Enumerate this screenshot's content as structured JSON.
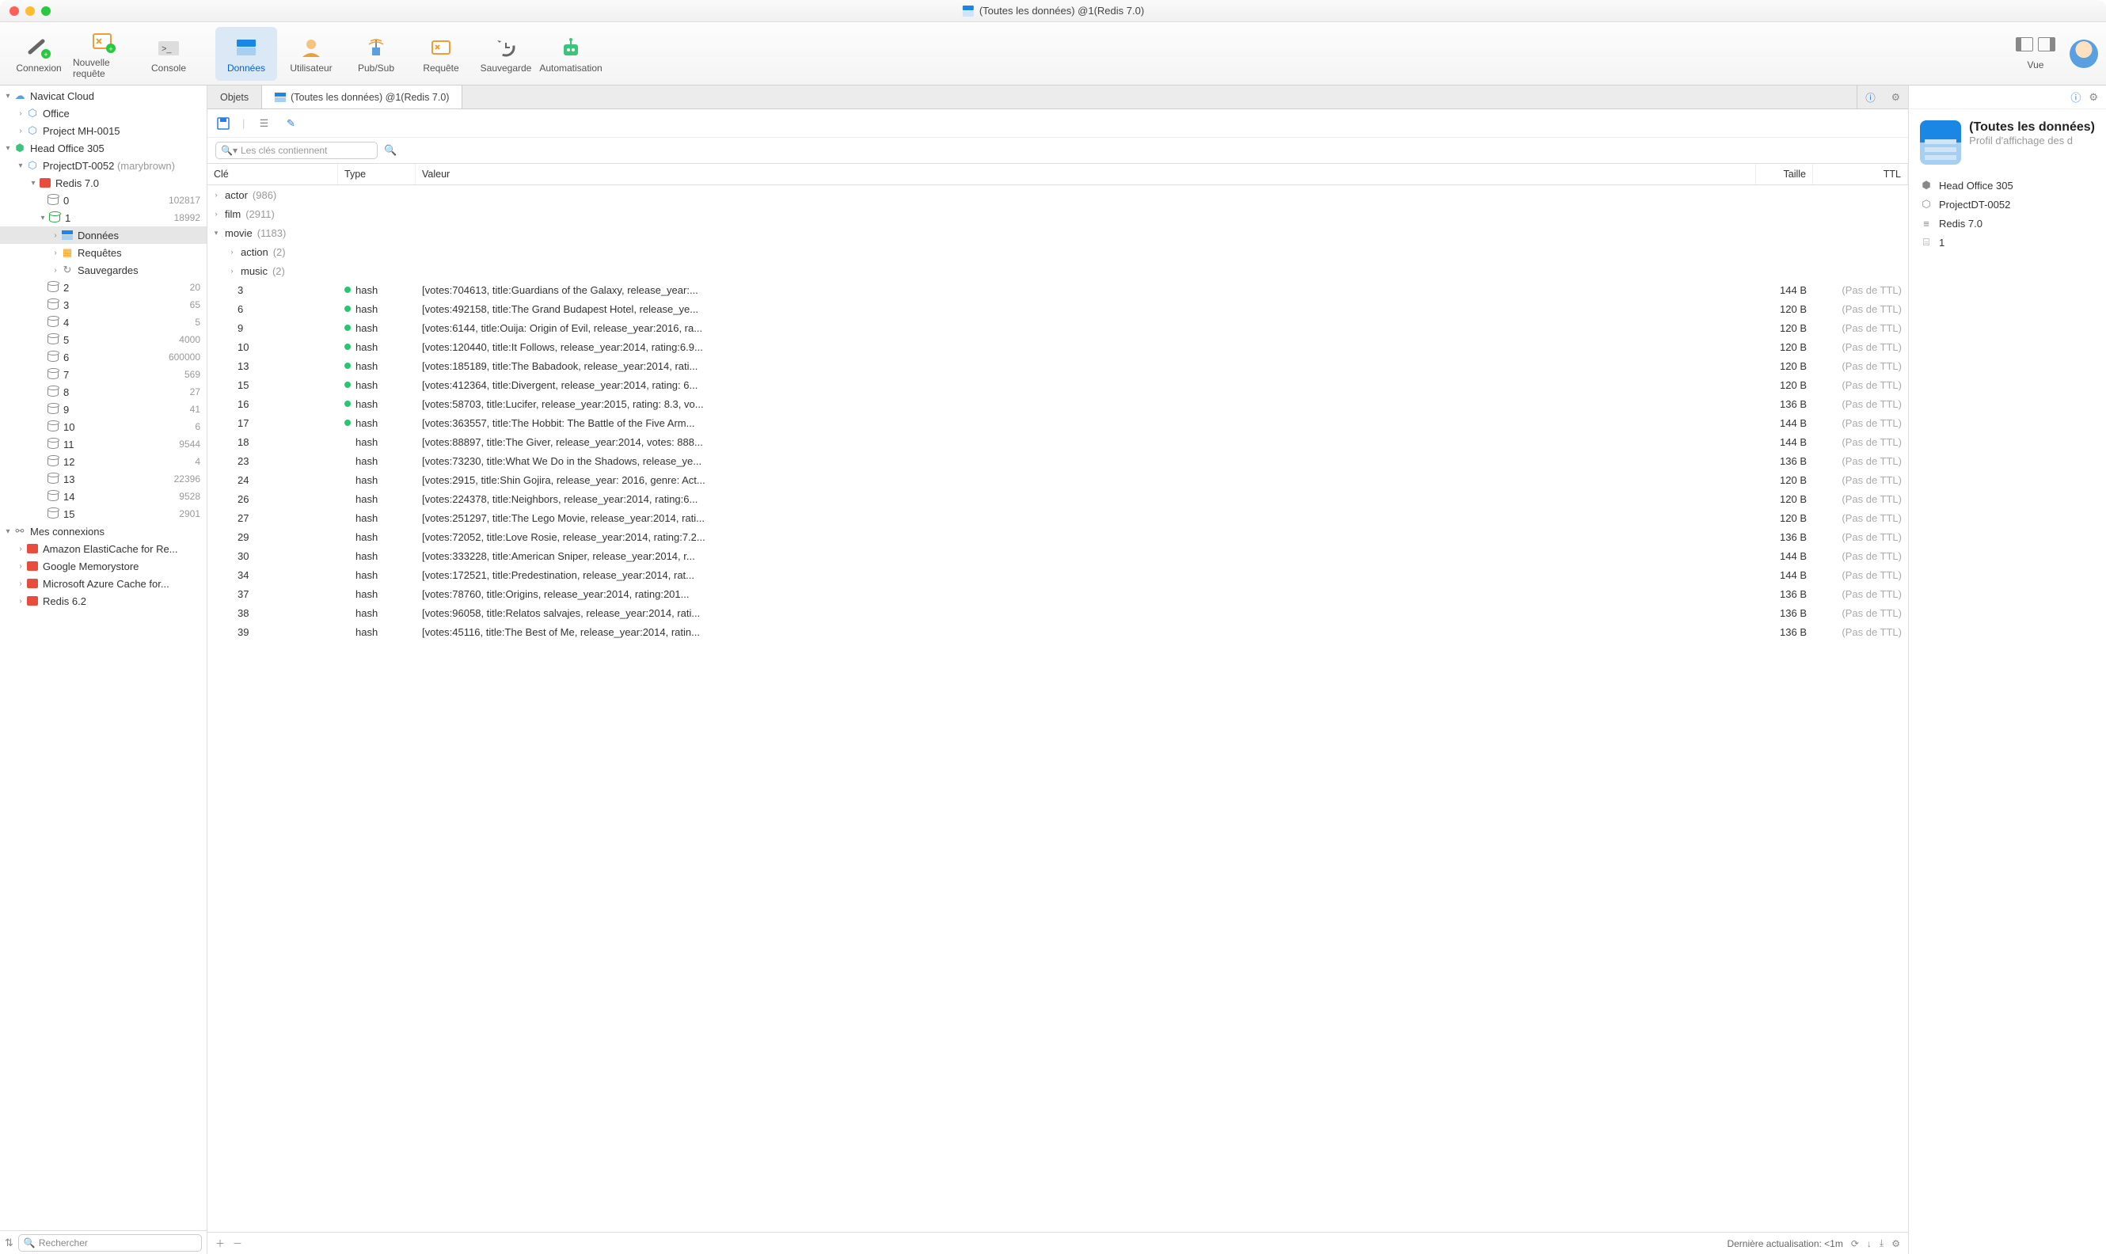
{
  "title": "(Toutes les données) @1(Redis 7.0)",
  "toolbar": {
    "connexion": "Connexion",
    "nouvelle_requete": "Nouvelle requête",
    "console": "Console",
    "donnees": "Données",
    "utilisateur": "Utilisateur",
    "pubsub": "Pub/Sub",
    "requete": "Requête",
    "sauvegarde": "Sauvegarde",
    "automatisation": "Automatisation",
    "vue": "Vue"
  },
  "sidebar": {
    "navicat_cloud": "Navicat Cloud",
    "office": "Office",
    "project_mh": "Project MH-0015",
    "head_office": "Head Office 305",
    "projectdt": "ProjectDT-0052",
    "projectdt_sub": "(marybrown)",
    "redis70": "Redis 7.0",
    "db0": "0",
    "db0_badge": "102817",
    "db1": "1",
    "db1_badge": "18992",
    "donnees": "Données",
    "requetes": "Requêtes",
    "sauvegardes": "Sauvegardes",
    "dbs": [
      {
        "n": "2",
        "b": "20"
      },
      {
        "n": "3",
        "b": "65"
      },
      {
        "n": "4",
        "b": "5"
      },
      {
        "n": "5",
        "b": "4000"
      },
      {
        "n": "6",
        "b": "600000"
      },
      {
        "n": "7",
        "b": "569"
      },
      {
        "n": "8",
        "b": "27"
      },
      {
        "n": "9",
        "b": "41"
      },
      {
        "n": "10",
        "b": "6"
      },
      {
        "n": "11",
        "b": "9544"
      },
      {
        "n": "12",
        "b": "4"
      },
      {
        "n": "13",
        "b": "22396"
      },
      {
        "n": "14",
        "b": "9528"
      },
      {
        "n": "15",
        "b": "2901"
      }
    ],
    "mes_connexions": "Mes connexions",
    "conn1": "Amazon ElastiCache for Re...",
    "conn2": "Google Memorystore",
    "conn3": "Microsoft Azure Cache for...",
    "conn4": "Redis 6.2",
    "search_placeholder": "Rechercher"
  },
  "tabs": {
    "objets": "Objets",
    "data_tab": "(Toutes les données) @1(Redis 7.0)"
  },
  "filter": {
    "placeholder": "Les clés contiennent"
  },
  "columns": {
    "cle": "Clé",
    "type": "Type",
    "valeur": "Valeur",
    "taille": "Taille",
    "ttl": "TTL"
  },
  "groups": {
    "actor": "actor",
    "actor_n": "(986)",
    "film": "film",
    "film_n": "(2911)",
    "movie": "movie",
    "movie_n": "(1183)",
    "action": "action",
    "action_n": "(2)",
    "music": "music",
    "music_n": "(2)"
  },
  "rows": [
    {
      "k": "3",
      "dot": true,
      "t": "hash",
      "v": "[votes:704613, title:Guardians of the Galaxy, release_year:...",
      "s": "144 B",
      "ttl": "(Pas de TTL)"
    },
    {
      "k": "6",
      "dot": true,
      "t": "hash",
      "v": "[votes:492158, title:The Grand Budapest Hotel, release_ye...",
      "s": "120 B",
      "ttl": "(Pas de TTL)"
    },
    {
      "k": "9",
      "dot": true,
      "t": "hash",
      "v": "[votes:6144, title:Ouija: Origin of Evil, release_year:2016, ra...",
      "s": "120 B",
      "ttl": "(Pas de TTL)"
    },
    {
      "k": "10",
      "dot": true,
      "t": "hash",
      "v": "[votes:120440, title:It Follows, release_year:2014, rating:6.9...",
      "s": "120 B",
      "ttl": "(Pas de TTL)"
    },
    {
      "k": "13",
      "dot": true,
      "t": "hash",
      "v": "[votes:185189, title:The Babadook, release_year:2014, rati...",
      "s": "120 B",
      "ttl": "(Pas de TTL)"
    },
    {
      "k": "15",
      "dot": true,
      "t": "hash",
      "v": "[votes:412364, title:Divergent, release_year:2014, rating: 6...",
      "s": "120 B",
      "ttl": "(Pas de TTL)"
    },
    {
      "k": "16",
      "dot": true,
      "t": "hash",
      "v": "[votes:58703, title:Lucifer, release_year:2015, rating: 8.3, vo...",
      "s": "136 B",
      "ttl": "(Pas de TTL)"
    },
    {
      "k": "17",
      "dot": true,
      "t": "hash",
      "v": "[votes:363557, title:The Hobbit: The Battle of the Five Arm...",
      "s": "144 B",
      "ttl": "(Pas de TTL)"
    },
    {
      "k": "18",
      "dot": false,
      "t": "hash",
      "v": "[votes:88897, title:The Giver, release_year:2014, votes: 888...",
      "s": "144 B",
      "ttl": "(Pas de TTL)"
    },
    {
      "k": "23",
      "dot": false,
      "t": "hash",
      "v": "[votes:73230, title:What We Do in the Shadows, release_ye...",
      "s": "136 B",
      "ttl": "(Pas de TTL)"
    },
    {
      "k": "24",
      "dot": false,
      "t": "hash",
      "v": "[votes:2915, title:Shin Gojira, release_year: 2016, genre: Act...",
      "s": "120 B",
      "ttl": "(Pas de TTL)"
    },
    {
      "k": "26",
      "dot": false,
      "t": "hash",
      "v": "[votes:224378, title:Neighbors, release_year:2014, rating:6...",
      "s": "120 B",
      "ttl": "(Pas de TTL)"
    },
    {
      "k": "27",
      "dot": false,
      "t": "hash",
      "v": "[votes:251297, title:The Lego Movie, release_year:2014, rati...",
      "s": "120 B",
      "ttl": "(Pas de TTL)"
    },
    {
      "k": "29",
      "dot": false,
      "t": "hash",
      "v": "[votes:72052, title:Love Rosie, release_year:2014, rating:7.2...",
      "s": "136 B",
      "ttl": "(Pas de TTL)"
    },
    {
      "k": "30",
      "dot": false,
      "t": "hash",
      "v": "[votes:333228, title:American Sniper, release_year:2014, r...",
      "s": "144 B",
      "ttl": "(Pas de TTL)"
    },
    {
      "k": "34",
      "dot": false,
      "t": "hash",
      "v": "[votes:172521, title:Predestination, release_year:2014, rat...",
      "s": "144 B",
      "ttl": "(Pas de TTL)"
    },
    {
      "k": "37",
      "dot": false,
      "t": "hash",
      "v": "[votes:78760, title:Origins, release_year:2014, rating:201...",
      "s": "136 B",
      "ttl": "(Pas de TTL)"
    },
    {
      "k": "38",
      "dot": false,
      "t": "hash",
      "v": "[votes:96058, title:Relatos salvajes, release_year:2014, rati...",
      "s": "136 B",
      "ttl": "(Pas de TTL)"
    },
    {
      "k": "39",
      "dot": false,
      "t": "hash",
      "v": "[votes:45116, title:The Best of Me, release_year:2014, ratin...",
      "s": "136 B",
      "ttl": "(Pas de TTL)"
    }
  ],
  "status": {
    "last_refresh": "Dernière actualisation: <1m"
  },
  "info": {
    "title": "(Toutes les données)",
    "subtitle": "Profil d'affichage des d",
    "items": {
      "head_office": "Head Office 305",
      "project": "ProjectDT-0052",
      "redis": "Redis 7.0",
      "db": "1"
    }
  }
}
